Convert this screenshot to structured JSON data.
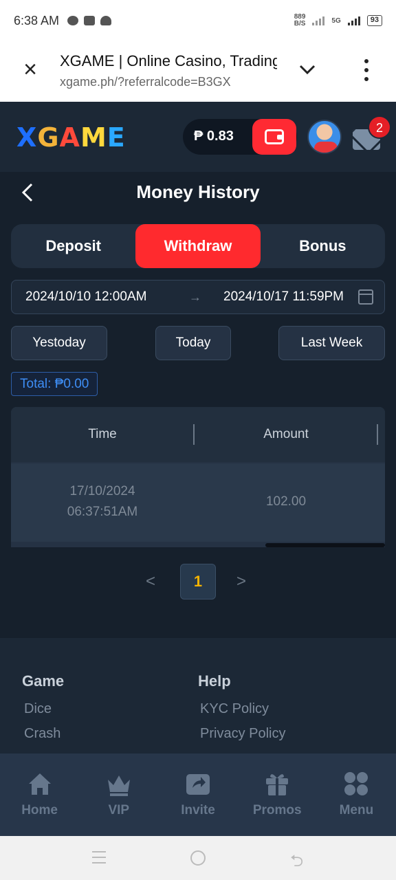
{
  "status_bar": {
    "time": "6:38 AM",
    "net_speed_value": "889",
    "net_speed_unit": "B/S",
    "network": "5G",
    "battery": "93"
  },
  "browser": {
    "title": "XGAME | Online Casino, Trading",
    "url": "xgame.ph/?referralcode=B3GX"
  },
  "header": {
    "logo": {
      "x": "X",
      "g": "G",
      "a": "A",
      "m": "M",
      "e": "E"
    },
    "balance": "₱ 0.83",
    "mail_count": "2"
  },
  "page": {
    "title": "Money History",
    "tabs": [
      {
        "label": "Deposit",
        "active": false
      },
      {
        "label": "Withdraw",
        "active": true
      },
      {
        "label": "Bonus",
        "active": false
      }
    ],
    "date_start": "2024/10/10 12:00AM",
    "date_arrow": "→",
    "date_end": "2024/10/17 11:59PM",
    "quick_ranges": [
      "Yestoday",
      "Today",
      "Last Week"
    ],
    "total": "Total: ₱0.00"
  },
  "table": {
    "columns": [
      "Time",
      "Amount"
    ],
    "rows": [
      {
        "date": "17/10/2024",
        "time": "06:37:51AM",
        "amount": "102.00"
      }
    ]
  },
  "pagination": {
    "prev": "<",
    "current": "1",
    "next": ">"
  },
  "footer": {
    "game": {
      "heading": "Game",
      "links": [
        "Dice",
        "Crash"
      ]
    },
    "help": {
      "heading": "Help",
      "links": [
        "KYC Policy",
        "Privacy Policy"
      ]
    }
  },
  "bottom_nav": [
    {
      "label": "Home",
      "icon": "home-icon"
    },
    {
      "label": "VIP",
      "icon": "crown-icon"
    },
    {
      "label": "Invite",
      "icon": "invite-icon"
    },
    {
      "label": "Promos",
      "icon": "gift-icon"
    },
    {
      "label": "Menu",
      "icon": "menu-grid-icon"
    }
  ],
  "colors": {
    "accent_red": "#ff2a2e",
    "background": "#16202c",
    "link_blue": "#3e8ef5",
    "page_gold": "#f5b300"
  }
}
